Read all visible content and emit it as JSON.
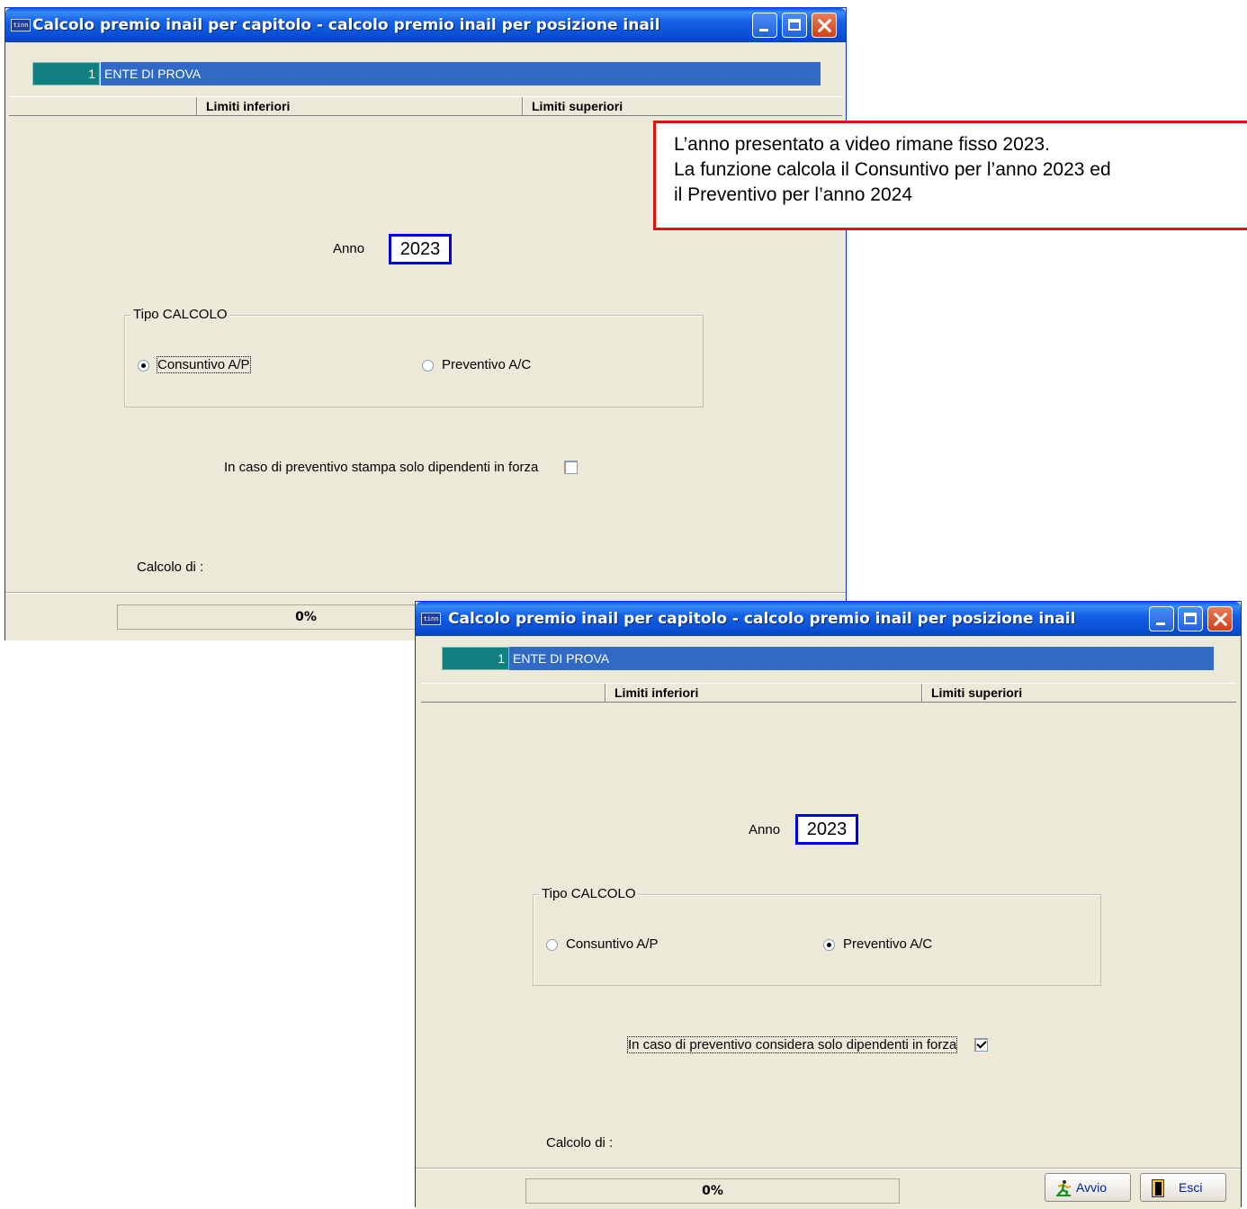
{
  "window_title": "Calcolo premio inail per capitolo - calcolo premio inail per posizione inail",
  "title_icon_text": "tinn",
  "ente": {
    "code": "1",
    "name": "ENTE DI PROVA"
  },
  "headers": {
    "lower": "Limiti inferiori",
    "upper": "Limiti superiori"
  },
  "anno": {
    "label": "Anno",
    "value": "2023"
  },
  "tipo_calcolo": {
    "title": "Tipo CALCOLO",
    "consuntivo": "Consuntivo A/P",
    "preventivo": "Preventivo A/C"
  },
  "window1": {
    "selected": "consuntivo",
    "checkbox_label": "In caso di preventivo stampa solo dipendenti in forza",
    "checkbox_checked": false
  },
  "window2": {
    "selected": "preventivo",
    "checkbox_label": "In caso di preventivo considera solo dipendenti in forza",
    "checkbox_checked": true
  },
  "calcolo_di_label": "Calcolo di :",
  "progress": {
    "value": 0,
    "text": "0%"
  },
  "buttons": {
    "avvio": "Avvio",
    "esci": "Esci"
  },
  "callout": {
    "line1": "L’anno presentato a video rimane fisso 2023.",
    "line2": "La funzione calcola il Consuntivo per l’anno 2023 ed",
    "line3": "il Preventivo per l’anno 2024"
  },
  "colors": {
    "titlebar": "#0a58e6",
    "window_bg": "#ece9d8",
    "ente_code_bg": "#108080",
    "ente_name_bg": "#316ac5",
    "anno_border": "#0000e6",
    "callout_border": "#e01010"
  }
}
